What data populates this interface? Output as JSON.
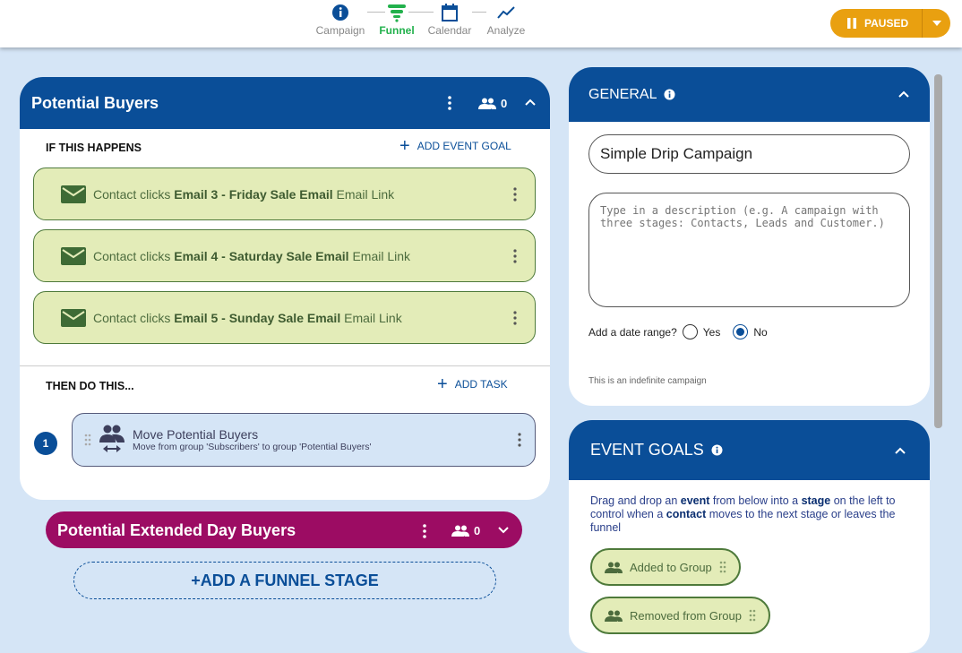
{
  "nav": {
    "steps": [
      {
        "label": "Campaign",
        "icon": "info-icon"
      },
      {
        "label": "Funnel",
        "icon": "funnel-icon",
        "active": true
      },
      {
        "label": "Calendar",
        "icon": "calendar-icon"
      },
      {
        "label": "Analyze",
        "icon": "trend-icon"
      }
    ],
    "status_button": "PAUSED"
  },
  "colors": {
    "primary": "#0a4e98",
    "accent_green": "#22b14c",
    "paused": "#e9a010",
    "stage2": "#9c0c63",
    "event_bg": "#e3ecb8"
  },
  "stage1": {
    "title": "Potential Buyers",
    "count": "0",
    "if_label": "IF THIS HAPPENS",
    "add_event": "ADD EVENT GOAL",
    "events": [
      {
        "pre": "Contact clicks ",
        "bold": "Email 3 - Friday Sale Email",
        "post": " Email Link"
      },
      {
        "pre": "Contact clicks ",
        "bold": "Email 4 - Saturday Sale Email",
        "post": " Email Link"
      },
      {
        "pre": "Contact clicks ",
        "bold": "Email 5 - Sunday Sale Email",
        "post": " Email Link"
      }
    ],
    "then_label": "THEN DO THIS...",
    "add_task": "ADD TASK",
    "tasks": [
      {
        "number": "1",
        "title": "Move Potential Buyers",
        "subtitle": "Move from group 'Subscribers' to group 'Potential Buyers'"
      }
    ]
  },
  "stage2": {
    "title": "Potential Extended Day Buyers",
    "count": "0"
  },
  "add_stage": "ADD A FUNNEL STAGE",
  "general": {
    "title": "GENERAL",
    "name_value": "Simple Drip Campaign",
    "desc_placeholder": "Type in a description (e.g. A campaign with three stages: Contacts, Leads and Customer.)",
    "date_label": "Add a date range?",
    "yes": "Yes",
    "no": "No",
    "selected": "No",
    "note": "This is an indefinite campaign"
  },
  "event_goals": {
    "title": "EVENT GOALS",
    "desc": [
      {
        "t": "Drag and drop an "
      },
      {
        "b": "event"
      },
      {
        "t": " from below into a "
      },
      {
        "b": "stage"
      },
      {
        "t": " on the left to control when a "
      },
      {
        "b": "contact"
      },
      {
        "t": " moves to the next stage or leaves the funnel"
      }
    ],
    "chips": [
      "Added to Group",
      "Removed from Group"
    ]
  }
}
